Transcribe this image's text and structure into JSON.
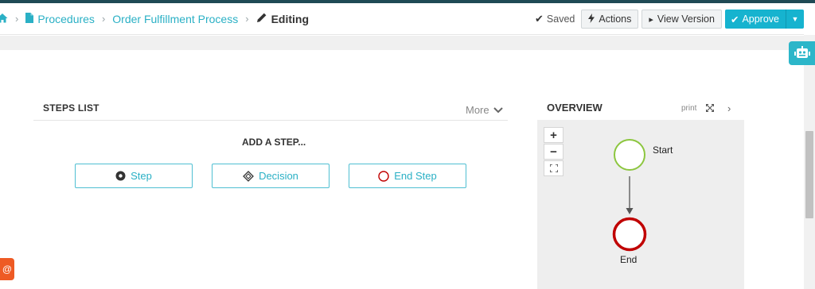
{
  "breadcrumb": {
    "items": [
      "Procedures",
      "Order Fulfillment Process",
      "Editing"
    ]
  },
  "toolbar": {
    "saved_label": "Saved",
    "actions_label": "Actions",
    "view_version_label": "View Version",
    "approve_label": "Approve"
  },
  "steps": {
    "title": "STEPS LIST",
    "more_label": "More",
    "add_step_label": "ADD A STEP...",
    "buttons": [
      "Step",
      "Decision",
      "End Step"
    ]
  },
  "overview": {
    "title": "OVERVIEW",
    "print_label": "print",
    "zoom_in": "+",
    "zoom_out": "−",
    "nodes": [
      "Start",
      "End"
    ]
  },
  "icons": {
    "home": "home-icon",
    "document": "document-icon",
    "pencil": "pencil-icon",
    "check": "check-icon",
    "bolt": "bolt-icon",
    "play": "play-icon",
    "robot": "robot-icon",
    "at": "at-icon"
  },
  "colors": {
    "accent": "#16b3cf",
    "start_node": "#8cc63f",
    "end_node": "#c00000",
    "top_stripe": "#1f4a55",
    "feedback": "#ee5a24"
  },
  "feedback": {
    "at_label": "@"
  }
}
